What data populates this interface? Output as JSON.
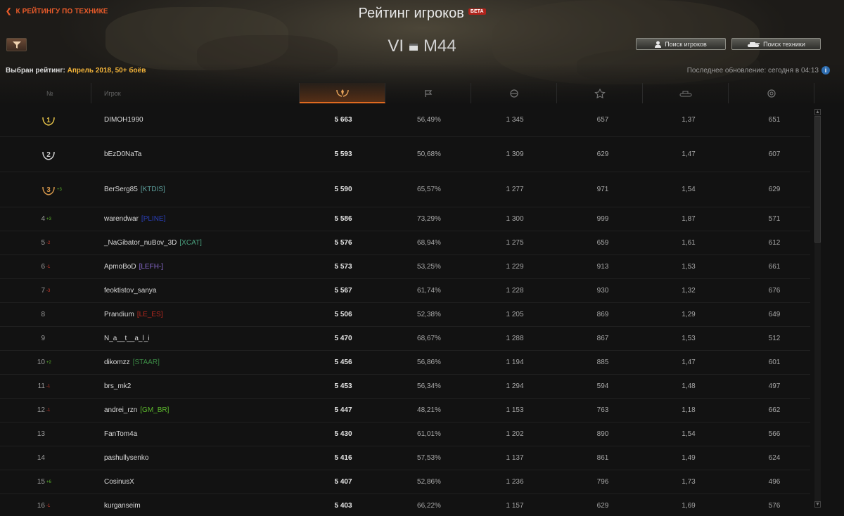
{
  "header": {
    "back_link": "К РЕЙТИНГУ ПО ТЕХНИКЕ",
    "title": "Рейтинг игроков",
    "badge": "БЕТА",
    "tier": "VI",
    "vehicle": "M44",
    "search_players": "Поиск игроков",
    "search_vehicles": "Поиск техники",
    "selected_label": "Выбран рейтинг:",
    "selected_value": "Апрель 2018, 50+ боёв",
    "last_update": "Последнее обновление: сегодня в 04:13"
  },
  "columns": {
    "rank": "№",
    "player": "Игрок"
  },
  "colors": {
    "accent": "#e06a20",
    "rating_highlight": "#f3b43a",
    "up": "#5cb82c",
    "down": "#d13a2a"
  },
  "rows": [
    {
      "rank": "1",
      "medal": "gold",
      "delta": "",
      "player": "DIMOH1990",
      "clan": "",
      "clan_color": "",
      "rating": "5 663",
      "winrate": "56,49%",
      "damage": "1 345",
      "xp": "657",
      "kd": "1,37",
      "spotted": "651"
    },
    {
      "rank": "2",
      "medal": "silver",
      "delta": "",
      "player": "bEzD0NaTa",
      "clan": "",
      "clan_color": "",
      "rating": "5 593",
      "winrate": "50,68%",
      "damage": "1 309",
      "xp": "629",
      "kd": "1,47",
      "spotted": "607"
    },
    {
      "rank": "3",
      "medal": "bronze",
      "delta": "+3",
      "player": "BerSerg85",
      "clan": "[KTDIS]",
      "clan_color": "#5fa3a0",
      "rating": "5 590",
      "winrate": "65,57%",
      "damage": "1 277",
      "xp": "971",
      "kd": "1,54",
      "spotted": "629"
    },
    {
      "rank": "4",
      "medal": "",
      "delta": "+3",
      "player": "warendwar",
      "clan": "[PLINE]",
      "clan_color": "#2a3fb8",
      "rating": "5 586",
      "winrate": "73,29%",
      "damage": "1 300",
      "xp": "999",
      "kd": "1,87",
      "spotted": "571"
    },
    {
      "rank": "5",
      "medal": "",
      "delta": "-2",
      "player": "_NaGibator_nuBov_3D",
      "clan": "[XCAT]",
      "clan_color": "#4aa07e",
      "rating": "5 576",
      "winrate": "68,94%",
      "damage": "1 275",
      "xp": "659",
      "kd": "1,61",
      "spotted": "612"
    },
    {
      "rank": "6",
      "medal": "",
      "delta": "-1",
      "player": "ApmoBoD",
      "clan": "[LEFH-]",
      "clan_color": "#8a6bd0",
      "rating": "5 573",
      "winrate": "53,25%",
      "damage": "1 229",
      "xp": "913",
      "kd": "1,53",
      "spotted": "661"
    },
    {
      "rank": "7",
      "medal": "",
      "delta": "-3",
      "player": "feoktistov_sanya",
      "clan": "",
      "clan_color": "",
      "rating": "5 567",
      "winrate": "61,74%",
      "damage": "1 228",
      "xp": "930",
      "kd": "1,32",
      "spotted": "676"
    },
    {
      "rank": "8",
      "medal": "",
      "delta": "",
      "player": "Prandium",
      "clan": "[LE_ES]",
      "clan_color": "#b8291f",
      "rating": "5 506",
      "winrate": "52,38%",
      "damage": "1 205",
      "xp": "869",
      "kd": "1,29",
      "spotted": "649"
    },
    {
      "rank": "9",
      "medal": "",
      "delta": "",
      "player": "N_a__t__a_l_i",
      "clan": "",
      "clan_color": "",
      "rating": "5 470",
      "winrate": "68,67%",
      "damage": "1 288",
      "xp": "867",
      "kd": "1,53",
      "spotted": "512"
    },
    {
      "rank": "10",
      "medal": "",
      "delta": "+2",
      "player": "dikomzz",
      "clan": "[STAAR]",
      "clan_color": "#3c8c46",
      "rating": "5 456",
      "winrate": "56,86%",
      "damage": "1 194",
      "xp": "885",
      "kd": "1,47",
      "spotted": "601"
    },
    {
      "rank": "11",
      "medal": "",
      "delta": "-1",
      "player": "brs_mk2",
      "clan": "",
      "clan_color": "",
      "rating": "5 453",
      "winrate": "56,34%",
      "damage": "1 294",
      "xp": "594",
      "kd": "1,48",
      "spotted": "497"
    },
    {
      "rank": "12",
      "medal": "",
      "delta": "-1",
      "player": "andrei_rzn",
      "clan": "[GM_BR]",
      "clan_color": "#5cb82c",
      "rating": "5 447",
      "winrate": "48,21%",
      "damage": "1 153",
      "xp": "763",
      "kd": "1,18",
      "spotted": "662"
    },
    {
      "rank": "13",
      "medal": "",
      "delta": "",
      "player": "FanTom4a",
      "clan": "",
      "clan_color": "",
      "rating": "5 430",
      "winrate": "61,01%",
      "damage": "1 202",
      "xp": "890",
      "kd": "1,54",
      "spotted": "566"
    },
    {
      "rank": "14",
      "medal": "",
      "delta": "",
      "player": "pashullysenko",
      "clan": "",
      "clan_color": "",
      "rating": "5 416",
      "winrate": "57,53%",
      "damage": "1 137",
      "xp": "861",
      "kd": "1,49",
      "spotted": "624"
    },
    {
      "rank": "15",
      "medal": "",
      "delta": "+6",
      "player": "CosinusX",
      "clan": "",
      "clan_color": "",
      "rating": "5 407",
      "winrate": "52,86%",
      "damage": "1 236",
      "xp": "796",
      "kd": "1,73",
      "spotted": "496"
    },
    {
      "rank": "16",
      "medal": "",
      "delta": "-1",
      "player": "kurganseim",
      "clan": "",
      "clan_color": "",
      "rating": "5 403",
      "winrate": "66,22%",
      "damage": "1 157",
      "xp": "629",
      "kd": "1,69",
      "spotted": "576"
    }
  ]
}
